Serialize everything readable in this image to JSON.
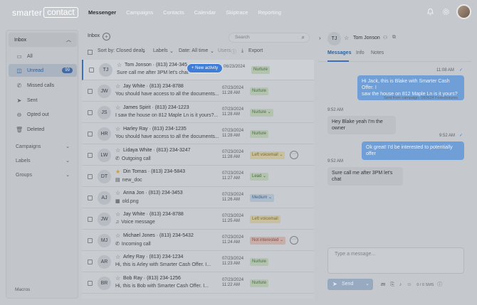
{
  "app": {
    "logo_part1": "smarter",
    "logo_part2": "contact",
    "nav": [
      "Messenger",
      "Campaigns",
      "Contacts",
      "Calendar",
      "Skiptrace",
      "Reporting"
    ]
  },
  "sidebar": {
    "header": "Inbox",
    "items": [
      {
        "label": "All",
        "icon": "inbox-icon"
      },
      {
        "label": "Unread",
        "icon": "unread-icon",
        "badge": "99"
      },
      {
        "label": "Missed calls",
        "icon": "missed-call-icon"
      },
      {
        "label": "Sent",
        "icon": "sent-icon"
      },
      {
        "label": "Opted out",
        "icon": "opted-out-icon"
      },
      {
        "label": "Deleted",
        "icon": "trash-icon"
      }
    ],
    "sections": [
      "Campaigns",
      "Labels",
      "Groups"
    ],
    "footer": "Macros"
  },
  "list": {
    "title": "Inbox",
    "search_placeholder": "Search",
    "sort": "Sort by: Closed deals",
    "labels": "Labels",
    "date": "Date: All time",
    "users": "Users",
    "export": "Export",
    "new_activity": "+ New activity",
    "rows": [
      {
        "initials": "TJ",
        "name": "Tom Jonson · (813) 234-345",
        "preview": "Sure call me after 3PM let's chat",
        "date": "06/23/2024",
        "time": "",
        "tag": "Nurture",
        "tag_color": "green",
        "star": false,
        "dots": false
      },
      {
        "initials": "JW",
        "name": "Jay White · (813) 234-8788",
        "preview": "You should have access to all the documents...",
        "date": "07/23/2024",
        "time": "11:28 AM",
        "tag": "Nurture",
        "tag_color": "green",
        "star": false,
        "dots": false
      },
      {
        "initials": "JS",
        "name": "James Spirit · (813) 234-1223",
        "preview": "I saw the house on 812 Maple Ln is it yours?...",
        "date": "07/23/2024",
        "time": "11:28 AM",
        "tag": "Nurture ⌄",
        "tag_color": "green",
        "star": false,
        "dots": false
      },
      {
        "initials": "HR",
        "name": "Harley Ray · (813) 234-1235",
        "preview": "You should have access to all the documents...",
        "date": "07/23/2024",
        "time": "11:28 AM",
        "tag": "Nurture",
        "tag_color": "green",
        "star": false,
        "dots": false
      },
      {
        "initials": "LW",
        "name": "Lidaya White · (813) 234-3247",
        "preview": "Outgoing call",
        "date": "07/23/2024",
        "time": "11:28 AM",
        "tag": "Left voicemail ⌄",
        "tag_color": "yellow",
        "star": false,
        "dots": true
      },
      {
        "initials": "DT",
        "name": "Din Tomas · (813) 234-5843",
        "preview": "new_doc",
        "date": "07/23/2024",
        "time": "11:27 AM",
        "tag": "Lead ⌄",
        "tag_color": "green",
        "star": true,
        "dots": false
      },
      {
        "initials": "AJ",
        "name": "Anna Jon · (813) 234-3453",
        "preview": "old.png",
        "date": "07/23/2024",
        "time": "11:26 AM",
        "tag": "Medium ⌄",
        "tag_color": "blue",
        "star": false,
        "dots": false
      },
      {
        "initials": "JW",
        "name": "Jay White · (813) 234-8788",
        "preview": "Voice message",
        "date": "07/23/2024",
        "time": "11:25 AM",
        "tag": "Left voicemail",
        "tag_color": "yellow",
        "star": false,
        "dots": false
      },
      {
        "initials": "MJ",
        "name": "Michael Jones · (813) 234-5432",
        "preview": "Incoming call",
        "date": "07/23/2024",
        "time": "11:24 AM",
        "tag": "Not interested ⌄",
        "tag_color": "red",
        "star": false,
        "dots": true
      },
      {
        "initials": "AR",
        "name": "Arley Ray · (813) 234-1234",
        "preview": "Hi, this is Arley with Smarter Cash Offer. I...",
        "date": "07/23/2024",
        "time": "11:23 AM",
        "tag": "Nurture",
        "tag_color": "green",
        "star": false,
        "dots": false
      },
      {
        "initials": "BR",
        "name": "Bob Ray · (813) 234-1256",
        "preview": "Hi, this is Bob with Smarter Cash Offer. I...",
        "date": "07/23/2024",
        "time": "11:22 AM",
        "tag": "Nurture",
        "tag_color": "green",
        "star": false,
        "dots": false
      }
    ]
  },
  "conversation": {
    "initials": "TJ",
    "name": "Tom Jonson",
    "tabs": [
      "Messages",
      "Info",
      "Notes"
    ],
    "messages": [
      {
        "dir": "out",
        "time": "11:08 AM",
        "text1": "Hi Jack, this is Blake with Smarter Cash Offer. I",
        "text2": "saw the house on 812 Maple Ln is it yours?",
        "note": "Sent from campaign: 060624 Foreclosures"
      },
      {
        "dir": "in",
        "time": "9:52 AM",
        "text1": "Hey Blake yeah I'm the owner"
      },
      {
        "dir": "out",
        "time": "9:52 AM",
        "text1": "Ok great! I'd be interested to potentially offer"
      },
      {
        "dir": "in",
        "time": "9:52 AM",
        "text1": "Sure call me after 3PM let's chat"
      }
    ],
    "compose_placeholder": "Type a message...",
    "send": "Send",
    "sms_count": "0 / 0 SMS"
  }
}
